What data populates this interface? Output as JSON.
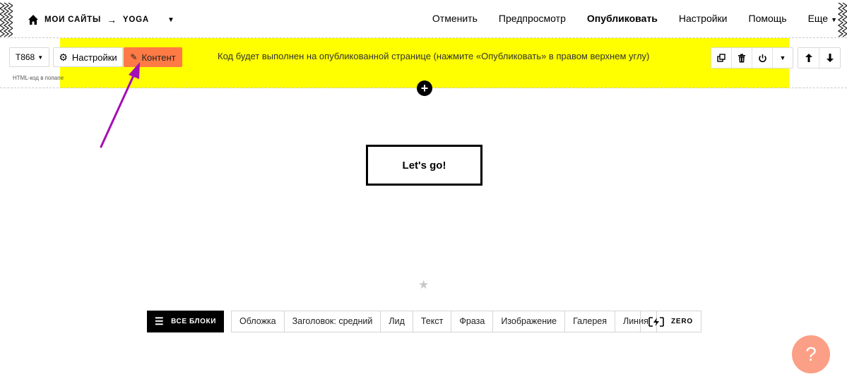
{
  "topbar": {
    "breadcrumb_root": "МОИ САЙТЫ",
    "breadcrumb_arrow": "→",
    "breadcrumb_site": "YOGA",
    "nav": {
      "cancel": "Отменить",
      "preview": "Предпросмотр",
      "publish": "Опубликовать",
      "settings": "Настройки",
      "help": "Помощь",
      "more": "Еще"
    }
  },
  "block": {
    "id_label": "T868",
    "settings_label": "Настройки",
    "content_label": "Контент",
    "subnote": "HTML-код в попапе",
    "notice": "Код будет выполнен на опубликованной странице (нажмите «Опубликовать» в правом верхнем углу)",
    "highlight_color": "#ffff00",
    "content_button_color": "#ff7a45"
  },
  "canvas": {
    "button_label": "Let's go!"
  },
  "library": {
    "all_blocks_label": "ВСЕ БЛОКИ",
    "categories": [
      "Обложка",
      "Заголовок: средний",
      "Лид",
      "Текст",
      "Фраза",
      "Изображение",
      "Галерея",
      "Линия"
    ],
    "zero_label": "ZERO"
  },
  "help_button": {
    "label": "?",
    "color": "#fb9f86"
  },
  "annotation": {
    "arrow_color": "#a40fb5"
  }
}
